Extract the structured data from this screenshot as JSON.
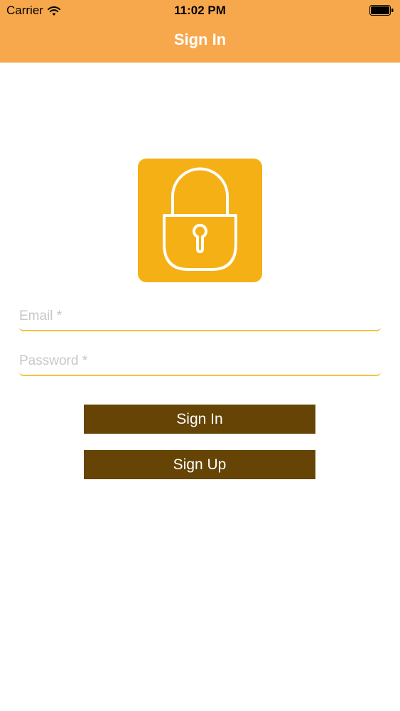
{
  "status_bar": {
    "carrier": "Carrier",
    "time": "11:02 PM",
    "wifi_icon": "wifi-icon",
    "battery_icon": "battery-icon"
  },
  "nav": {
    "title": "Sign In",
    "background_color": "#F7A84C"
  },
  "logo": {
    "icon": "lock-icon",
    "background_color": "#F5B016"
  },
  "form": {
    "email_placeholder": "Email *",
    "email_value": "",
    "password_placeholder": "Password *",
    "password_value": "",
    "underline_color": "#F5C242"
  },
  "buttons": {
    "sign_in_label": "Sign In",
    "sign_up_label": "Sign Up",
    "background_color": "#654406"
  }
}
